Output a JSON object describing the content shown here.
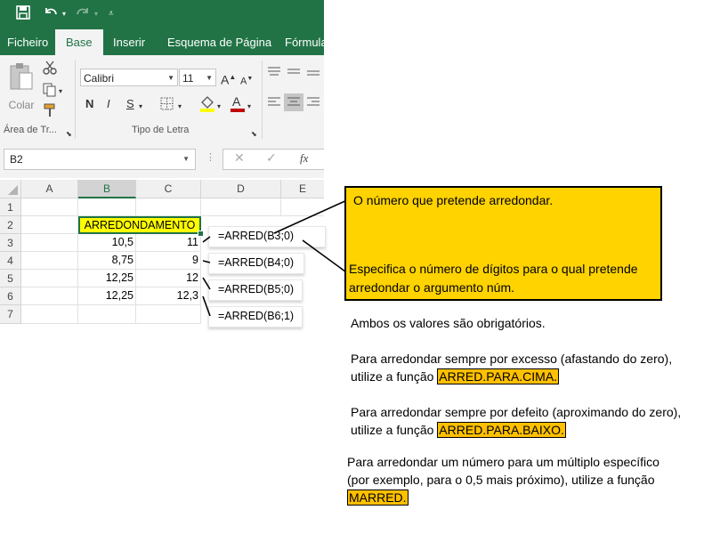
{
  "ribbon": {
    "tabs": [
      "Ficheiro",
      "Base",
      "Inserir",
      "Esquema de Página",
      "Fórmula"
    ],
    "active_tab": "Base",
    "paste_label": "Colar",
    "clipboard_group": "Área de Tr...",
    "font_group": "Tipo de Letra",
    "font_name": "Calibri",
    "font_size": "11",
    "bold": "N",
    "italic": "I",
    "underline": "S",
    "font_color": "#c00000",
    "highlight_color": "#ffff00"
  },
  "formula_bar": {
    "name_box": "B2",
    "fx": "fx",
    "cancel": "✕",
    "enter": "✓",
    "value": ""
  },
  "sheet": {
    "columns": [
      "A",
      "B",
      "C",
      "D",
      "E"
    ],
    "selected_column": "B",
    "rows": [
      "1",
      "2",
      "3",
      "4",
      "5",
      "6",
      "7"
    ],
    "header_cell": "ARREDONDAMENTO",
    "data": [
      {
        "b": "10,5",
        "c": "11",
        "formula": "=ARRED(B3;0)"
      },
      {
        "b": "8,75",
        "c": "9",
        "formula": "=ARRED(B4;0)"
      },
      {
        "b": "12,25",
        "c": "12",
        "formula": "=ARRED(B5;0)"
      },
      {
        "b": "12,25",
        "c": "12,3",
        "formula": "=ARRED(B6;1)"
      }
    ],
    "header_fill": "#ffff00"
  },
  "callout": {
    "line1": "O número que pretende arredondar.",
    "line2a": "Especifica o número de dígitos para o qual pretende",
    "line2b": "arredondar o argumento núm.",
    "fill": "#ffd300"
  },
  "notes": {
    "required": "Ambos os valores são obrigatórios.",
    "up_line1": "Para arredondar sempre por excesso (afastando do zero),",
    "up_line2": "utilize a função",
    "up_func": "ARRED.PARA.CIMA.",
    "down_line1": "Para arredondar sempre por defeito (aproximando do zero),",
    "down_line2": "utilize a função",
    "down_func": "ARRED.PARA.BAIXO.",
    "mult_line1": "Para arredondar um número para um múltiplo específico",
    "mult_line2": "(por exemplo, para o 0,5 mais próximo), utilize a função",
    "mult_func": "MARRED.",
    "highlight": "#ffc000"
  }
}
